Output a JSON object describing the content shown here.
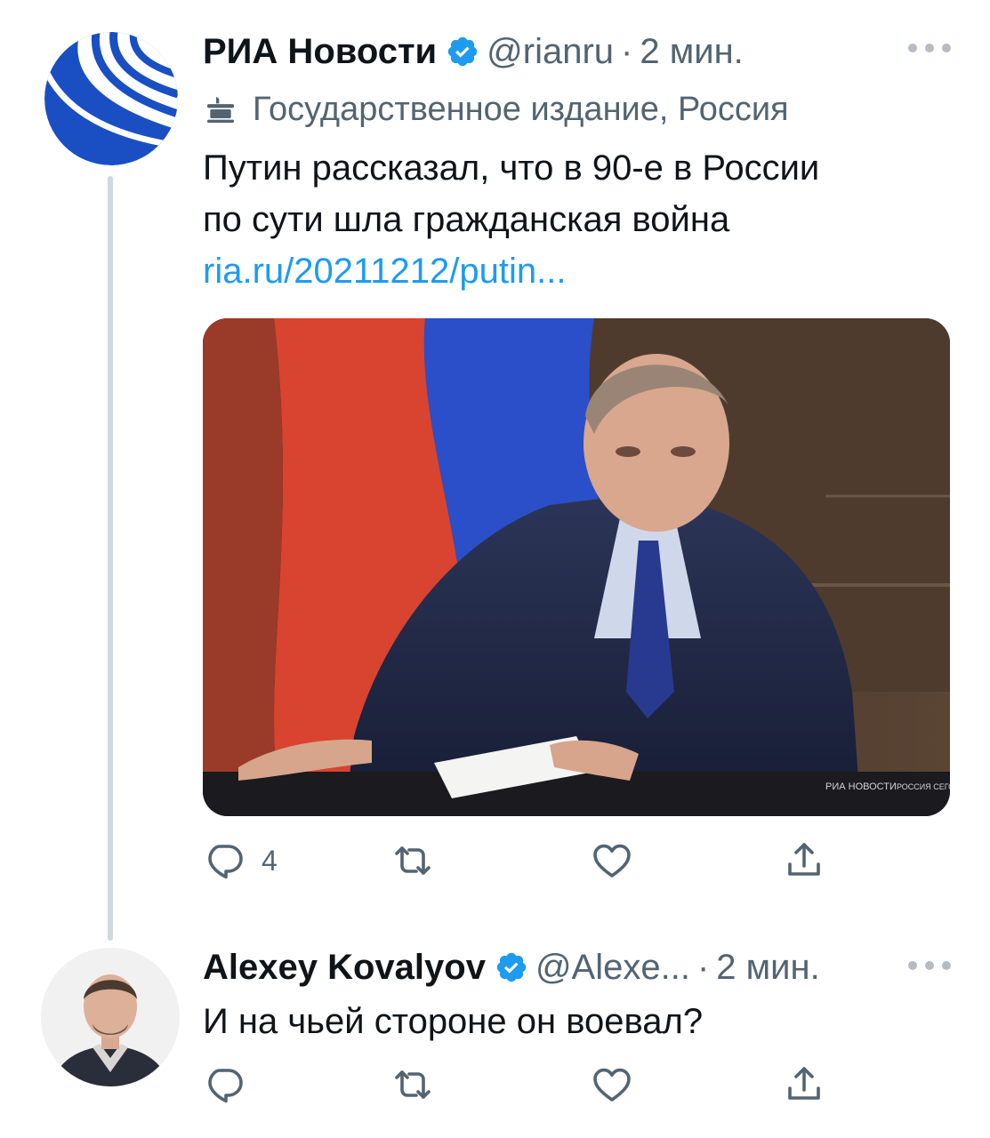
{
  "tweet1": {
    "author_name": "РИА Новости",
    "handle": "@rianru",
    "separator": "·",
    "time": "2 мин.",
    "label": "Государственное издание, Россия",
    "text_line1": "Путин рассказал, что в 90-е в России",
    "text_line2": "по сути шла гражданская война",
    "link": "ria.ru/20211212/putin...",
    "media_watermark_left": "РИА НОВОСТИ",
    "media_watermark_right": "РОССИЯ СЕГОДНЯ",
    "reply_count": "4",
    "retweet_count": "",
    "like_count": ""
  },
  "tweet2": {
    "author_name": "Alexey Kovalyov",
    "handle": "@Alexe...",
    "separator": "·",
    "time": "2 мин.",
    "text": "И на чьей стороне он воевал?",
    "reply_count": "",
    "retweet_count": "",
    "like_count": ""
  },
  "icons": {
    "verified": "verified-badge-icon",
    "label": "government-building-icon",
    "reply": "reply-icon",
    "retweet": "retweet-icon",
    "like": "heart-icon",
    "share": "share-icon",
    "more": "more-dots-icon"
  },
  "colors": {
    "link_blue": "#1d9bf0",
    "secondary_text": "#536471",
    "primary_text": "#0f1419",
    "ria_blue": "#1a4fc4",
    "thread_line": "#cfd9de"
  }
}
